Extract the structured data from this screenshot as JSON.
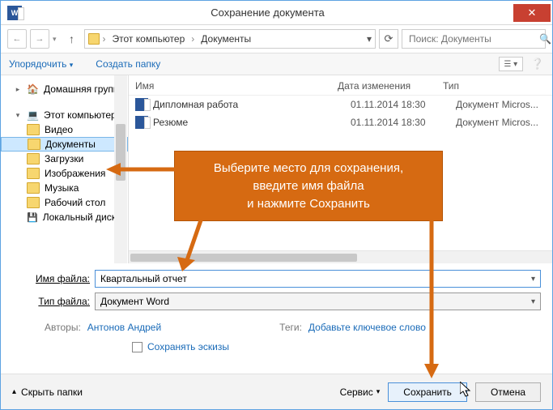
{
  "window": {
    "title": "Сохранение документа",
    "app_icon_text": "W"
  },
  "nav": {
    "breadcrumb": [
      {
        "label": "Этот компьютер"
      },
      {
        "label": "Документы"
      }
    ],
    "search_placeholder": "Поиск: Документы"
  },
  "toolbar": {
    "organize": "Упорядочить",
    "new_folder": "Создать папку"
  },
  "sidebar": {
    "items": [
      {
        "label": "Домашняя группа",
        "indent": false,
        "caret": "▸",
        "icon": "homegroup"
      },
      {
        "label": "Этот компьютер",
        "indent": false,
        "caret": "▾",
        "icon": "computer"
      },
      {
        "label": "Видео",
        "indent": true,
        "icon": "folder"
      },
      {
        "label": "Документы",
        "indent": true,
        "icon": "folder",
        "selected": true
      },
      {
        "label": "Загрузки",
        "indent": true,
        "icon": "folder"
      },
      {
        "label": "Изображения",
        "indent": true,
        "icon": "folder"
      },
      {
        "label": "Музыка",
        "indent": true,
        "icon": "folder"
      },
      {
        "label": "Рабочий стол",
        "indent": true,
        "icon": "folder"
      },
      {
        "label": "Локальный диск",
        "indent": true,
        "icon": "drive"
      }
    ]
  },
  "columns": {
    "name": "Имя",
    "date": "Дата изменения",
    "type": "Тип"
  },
  "files": [
    {
      "name": "Дипломная работа",
      "date": "01.11.2014 18:30",
      "type": "Документ Micros..."
    },
    {
      "name": "Резюме",
      "date": "01.11.2014 18:30",
      "type": "Документ Micros..."
    }
  ],
  "fields": {
    "filename_label": "Имя файла:",
    "filename_value": "Квартальный отчет",
    "filetype_label": "Тип файла:",
    "filetype_value": "Документ Word"
  },
  "meta": {
    "authors_label": "Авторы:",
    "authors_value": "Антонов Андрей",
    "tags_label": "Теги:",
    "tags_value": "Добавьте ключевое слово"
  },
  "checkbox": {
    "label": "Сохранять эскизы"
  },
  "footer": {
    "hide": "Скрыть папки",
    "service": "Сервис",
    "save": "Сохранить",
    "cancel": "Отмена"
  },
  "callout": {
    "line1": "Выберите место для сохранения,",
    "line2": "введите имя файла",
    "line3": "и нажмите Сохранить"
  }
}
